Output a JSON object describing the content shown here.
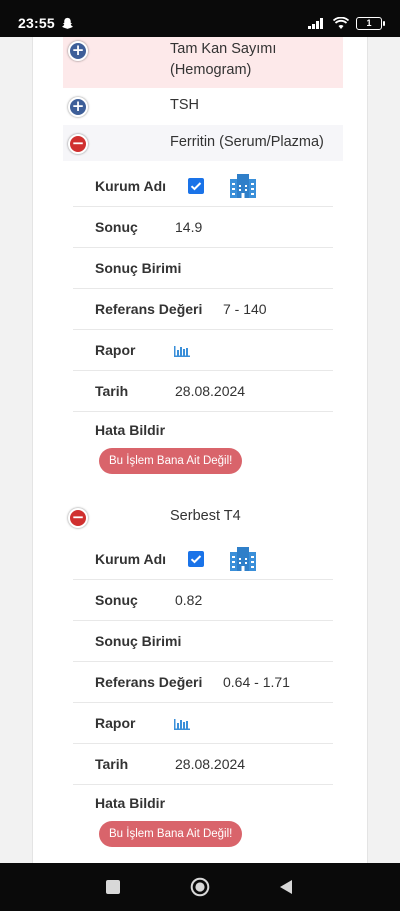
{
  "status_bar": {
    "time": "23:55",
    "battery": "1"
  },
  "tests": [
    {
      "name": "Tam Kan Sayımı (Hemogram)",
      "expanded": false
    },
    {
      "name": "TSH",
      "expanded": false
    },
    {
      "name": "Ferritin (Serum/Plazma)",
      "expanded": true
    },
    {
      "name": "Serbest T4",
      "expanded": true
    }
  ],
  "labels": {
    "institution": "Kurum Adı",
    "result": "Sonuç",
    "result_unit": "Sonuç Birimi",
    "reference": "Referans Değeri",
    "report": "Rapor",
    "date": "Tarih",
    "report_error": "Hata Bildir",
    "not_mine_button": "Bu İşlem Bana Ait Değil!"
  },
  "ferritin": {
    "result": "14.9",
    "unit": "",
    "reference": "7 - 140",
    "date": "28.08.2024"
  },
  "t4": {
    "result": "0.82",
    "unit": "",
    "reference": "0.64 - 1.71",
    "date": "28.08.2024"
  },
  "colors": {
    "plus": "#3e5f99",
    "minus": "#d0302f",
    "highlight_row": "#fde9ea",
    "button": "#d9646b",
    "icon_blue": "#3a8fd9"
  }
}
